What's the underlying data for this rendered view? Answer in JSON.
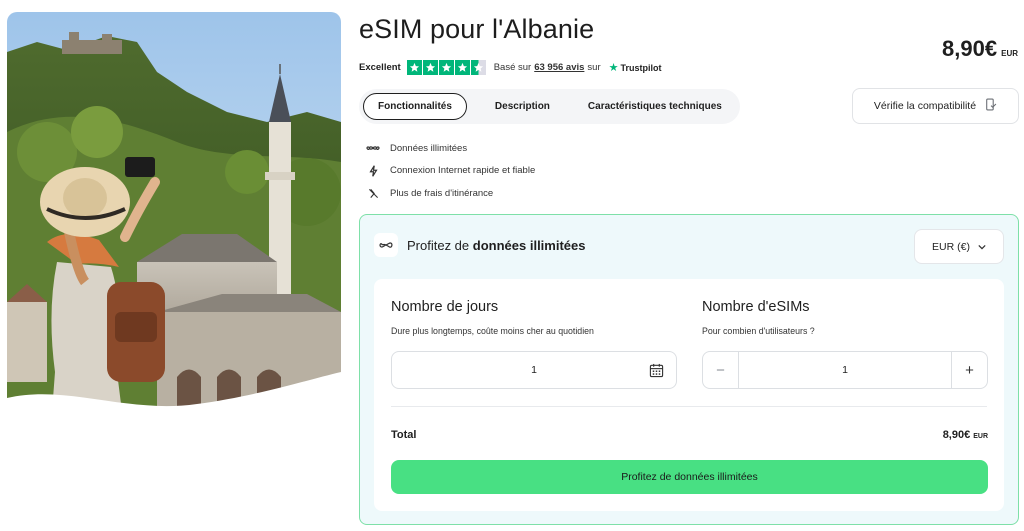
{
  "product": {
    "title": "eSIM pour l'Albanie",
    "price": "8,90€",
    "price_currency": "EUR"
  },
  "rating": {
    "label": "Excellent",
    "stars": 4.5,
    "text_before": "Basé sur",
    "count": "63 956 avis",
    "text_after": "sur",
    "provider": "Trustpilot",
    "color": "#00b67a"
  },
  "tabs": [
    {
      "label": "Fonctionnalités",
      "active": true
    },
    {
      "label": "Description",
      "active": false
    },
    {
      "label": "Caractéristiques techniques",
      "active": false
    }
  ],
  "compat_button": {
    "label": "Vérifie la compatibilité",
    "icon": "phone-check-icon"
  },
  "features": [
    {
      "icon": "infinity-icon",
      "label": "Données illimitées"
    },
    {
      "icon": "lightning-icon",
      "label": "Connexion Internet rapide et fiable"
    },
    {
      "icon": "no-roaming-icon",
      "label": "Plus de frais d'itinérance"
    }
  ],
  "offer": {
    "title_prefix": "Profitez de",
    "title_bold": "données illimitées",
    "currency_select": "EUR (€)",
    "days": {
      "title": "Nombre de jours",
      "subtitle": "Dure plus longtemps, coûte moins cher au quotidien",
      "value": "1"
    },
    "esims": {
      "title": "Nombre d'eSIMs",
      "subtitle": "Pour combien d'utilisateurs ?",
      "value": "1",
      "minus": "−",
      "plus": "+"
    },
    "total_label": "Total",
    "total_value": "8,90€",
    "total_currency": "EUR",
    "cta_label": "Profitez de données illimitées"
  },
  "colors": {
    "accent_green": "#48e083",
    "panel_bg": "#eef9fb",
    "panel_border": "#7ee0a8"
  }
}
